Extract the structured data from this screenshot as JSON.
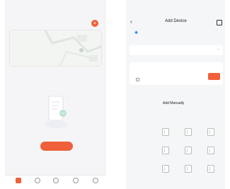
{
  "left_phone": {
    "status_time": "",
    "status_icons": "",
    "home_name": "",
    "add_icon": "plus-icon",
    "welcome": {
      "title": "",
      "subtitle": ""
    },
    "tabs": [
      "",
      "",
      "",
      "",
      ""
    ],
    "empty_text": "",
    "add_device_label": "",
    "nav": [
      {
        "label": "",
        "icon": "home-icon"
      },
      {
        "label": "",
        "icon": "smart-icon"
      },
      {
        "label": "",
        "icon": "mall-icon"
      },
      {
        "label": "",
        "icon": "ai-icon"
      },
      {
        "label": "",
        "icon": "profile-icon"
      }
    ],
    "accent_color": "#f0603a"
  },
  "right_phone": {
    "status_time": "",
    "status_icons": "",
    "title": "Add Device",
    "bluetooth_text": "",
    "gateway_label": "",
    "discover_label": "",
    "add_label": "",
    "manual_title": "Add Manually",
    "categories": [
      "",
      "",
      "",
      "",
      "",
      ""
    ],
    "column_header": "",
    "devices": [
      {
        "label": ""
      },
      {
        "label": ""
      },
      {
        "label": ""
      },
      {
        "label": ""
      },
      {
        "label": ""
      },
      {
        "label": ""
      },
      {
        "label": ""
      },
      {
        "label": ""
      },
      {
        "label": ""
      }
    ],
    "more_link": ""
  }
}
